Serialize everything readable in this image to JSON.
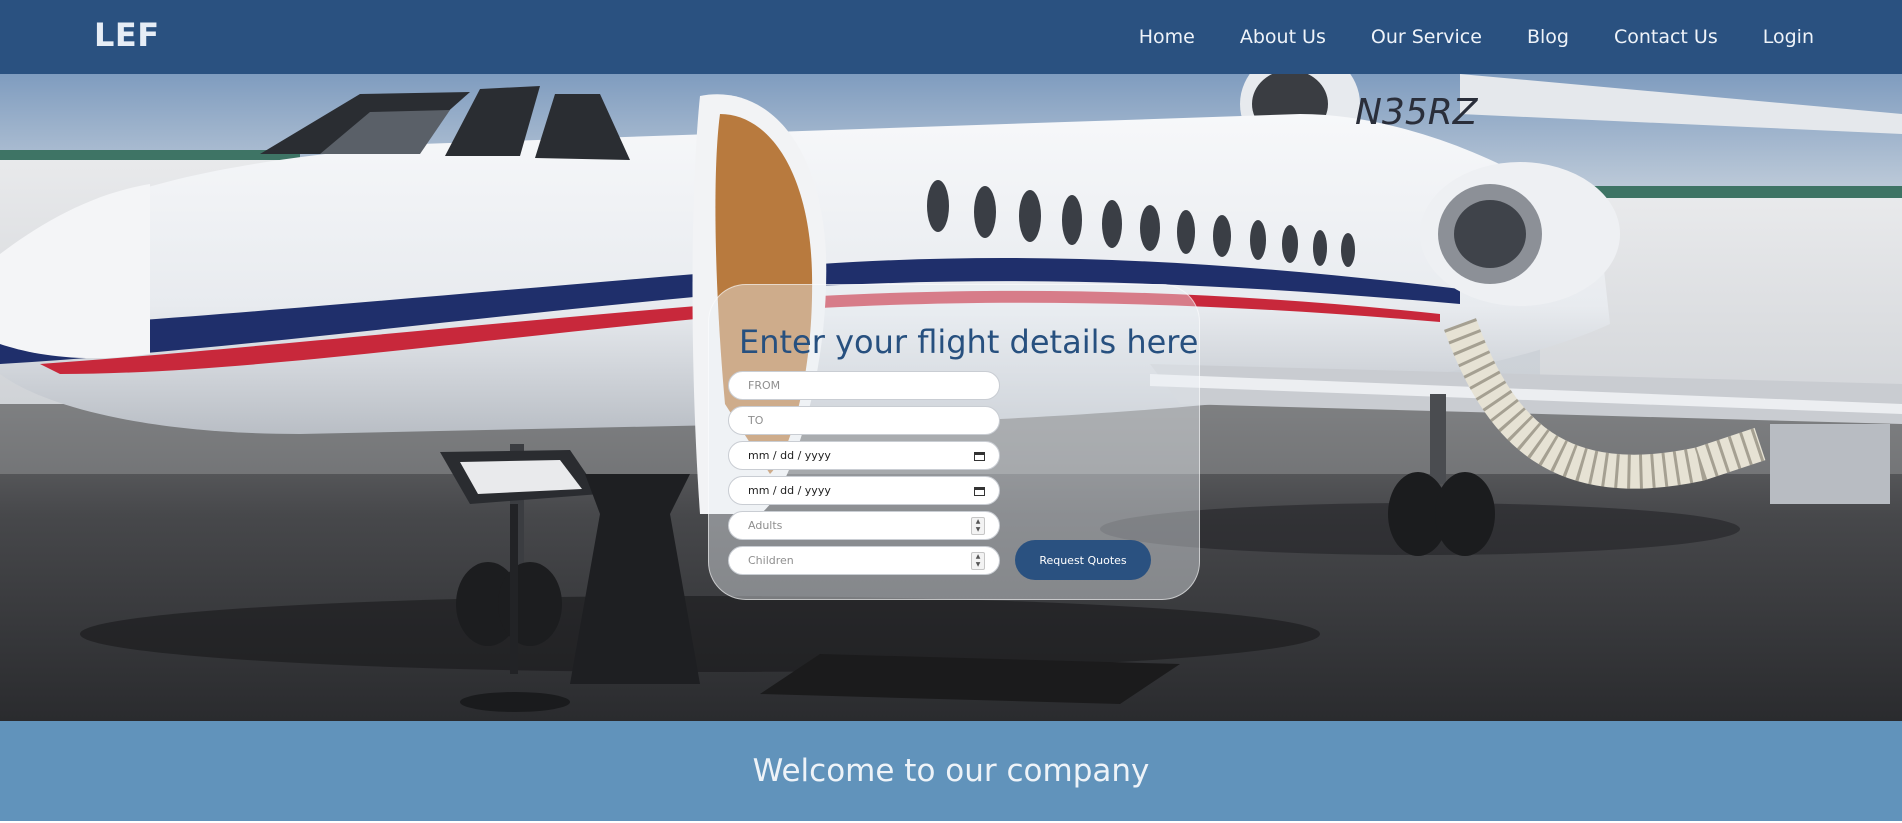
{
  "brand": {
    "logo_text": "LEF",
    "primary_color": "#2a5180",
    "band_color": "#6193bb"
  },
  "nav": {
    "items": [
      {
        "label": "Home"
      },
      {
        "label": "About Us"
      },
      {
        "label": "Our Service"
      },
      {
        "label": "Blog"
      },
      {
        "label": "Contact Us"
      },
      {
        "label": "Login"
      }
    ]
  },
  "hero": {
    "image": "private-jet-on-tarmac",
    "tail_number": "N35RZ"
  },
  "form": {
    "title": "Enter your flight details here",
    "from_placeholder": "FROM",
    "to_placeholder": "TO",
    "depart_date": "mm / dd / yyyy",
    "return_date": "mm / dd / yyyy",
    "adults_placeholder": "Adults",
    "children_placeholder": "Children",
    "submit_label": "Request Quotes"
  },
  "welcome": {
    "heading": "Welcome to our company"
  }
}
